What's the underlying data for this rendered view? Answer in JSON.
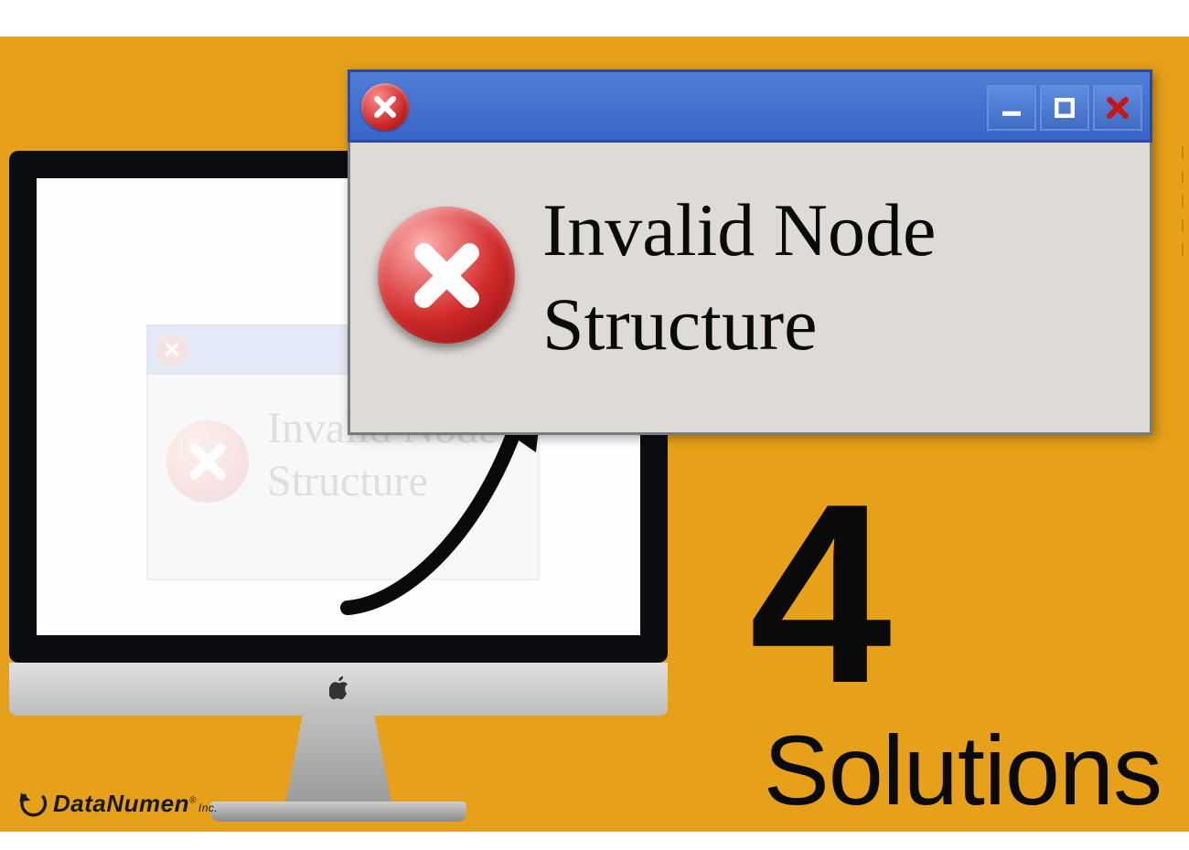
{
  "dialog": {
    "error_text": "Invalid Node\nStructure"
  },
  "headline": {
    "number": "4",
    "word": "Solutions"
  },
  "brand": {
    "name": "DataNumen",
    "suffix": "Inc.",
    "reg": "®"
  },
  "colors": {
    "bg": "#e7a019",
    "titlebar": "#3a66c9",
    "error_red": "#cc2a2a"
  },
  "icons": {
    "close_circle": "close-circle-icon",
    "minimize": "minimize-icon",
    "maximize": "maximize-icon",
    "win_close": "window-close-icon",
    "error_x": "error-x-icon",
    "apple": "apple-logo-icon",
    "arrow": "curved-arrow-icon",
    "brand": "datanumen-logo-icon"
  }
}
